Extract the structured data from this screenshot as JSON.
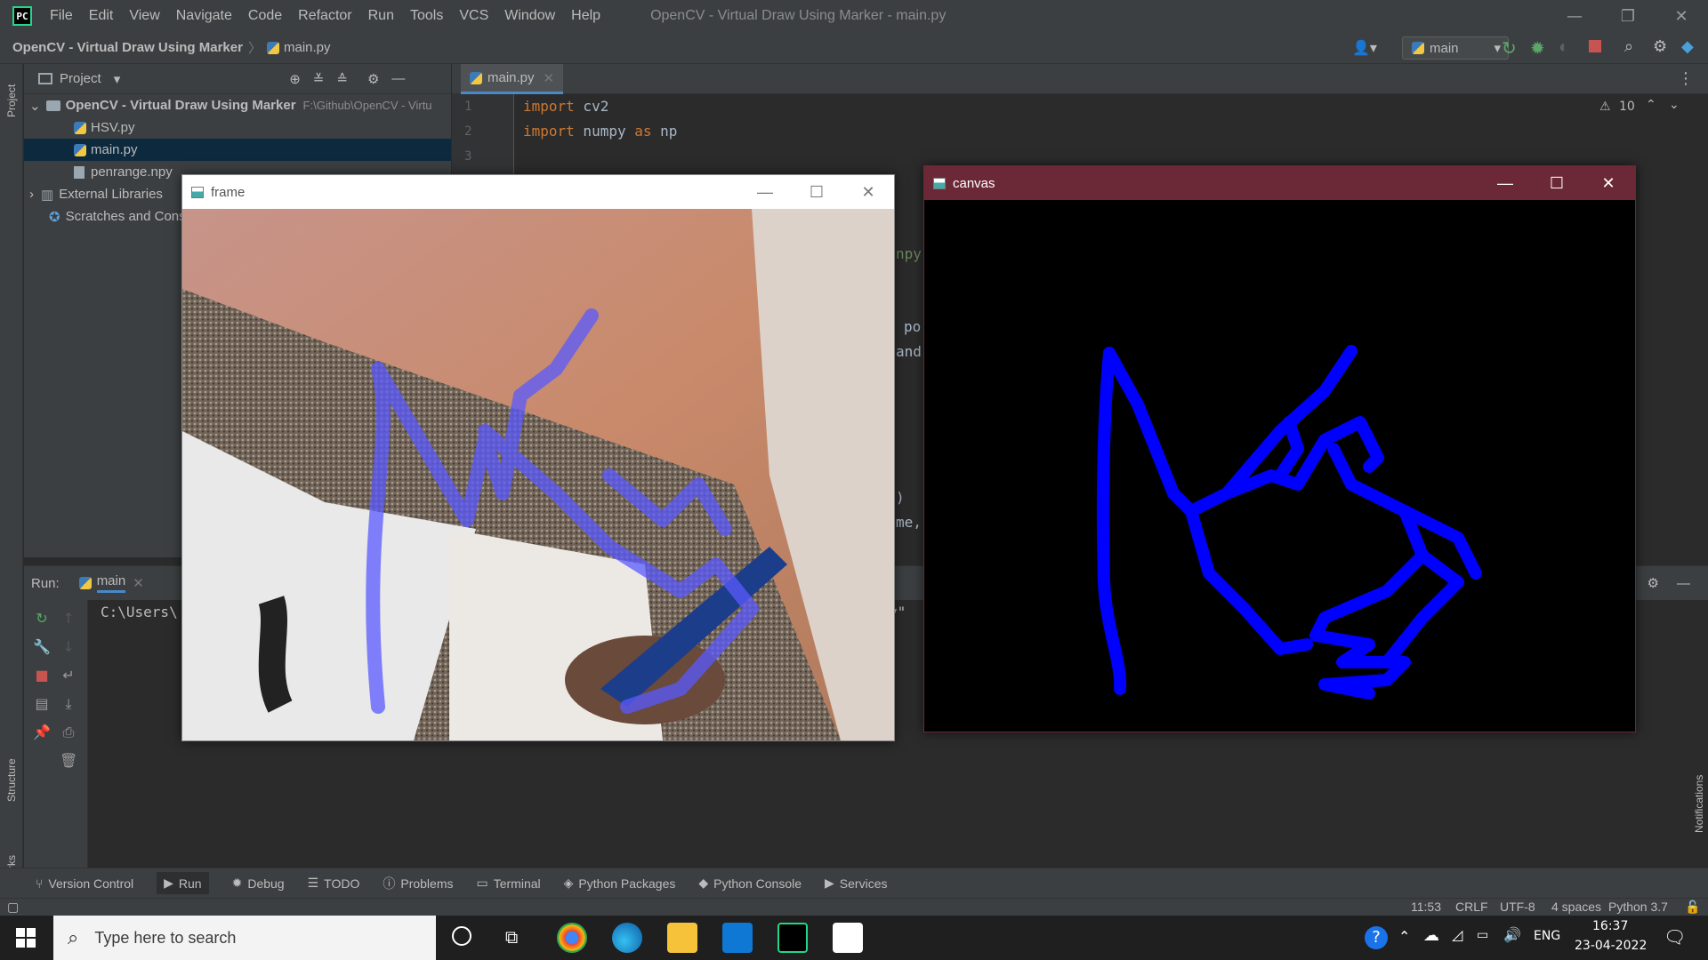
{
  "menu": {
    "items": [
      "File",
      "Edit",
      "View",
      "Navigate",
      "Code",
      "Refactor",
      "Run",
      "Tools",
      "VCS",
      "Window",
      "Help"
    ],
    "window_title": "OpenCV - Virtual Draw Using Marker - main.py"
  },
  "navbar": {
    "project": "OpenCV - Virtual Draw Using Marker",
    "file": "main.py",
    "run_config": "main"
  },
  "project_panel": {
    "title": "Project",
    "root": "OpenCV - Virtual Draw Using Marker",
    "root_path": "F:\\Github\\OpenCV - Virtu",
    "files": [
      "HSV.py",
      "main.py",
      "penrange.npy"
    ],
    "external": "External Libraries",
    "scratches": "Scratches and Cons"
  },
  "editor": {
    "tab": "main.py",
    "line_numbers": [
      "1",
      "2",
      "3"
    ],
    "line1_kw": "import",
    "line1_id": " cv2",
    "line2_kw": "import",
    "line2_id": " numpy ",
    "line2_as": "as",
    "line2_np": " np",
    "warnings": "10",
    "fragments": [
      "npy",
      "po",
      "and",
      ")",
      "me,",
      "y\""
    ]
  },
  "run_panel": {
    "label": "Run:",
    "tab": "main",
    "console": "C:\\Users\\"
  },
  "tool_strip": [
    "Version Control",
    "Run",
    "Debug",
    "TODO",
    "Problems",
    "Terminal",
    "Python Packages",
    "Python Console",
    "Services"
  ],
  "side_labels": {
    "project": "Project",
    "structure": "Structure",
    "bookmarks": "Bookmarks",
    "notifications": "Notifications"
  },
  "statusbar": {
    "position": "11:53",
    "line_sep": "CRLF",
    "encoding": "UTF-8",
    "indent": "4 spaces",
    "interpreter": "Python 3.7"
  },
  "frame_window": {
    "title": "frame"
  },
  "canvas_window": {
    "title": "canvas"
  },
  "taskbar": {
    "search_placeholder": "Type here to search",
    "language": "ENG",
    "time": "16:37",
    "date": "23-04-2022"
  },
  "colors": {
    "accent": "#4a88c7",
    "stroke": "#0000ff",
    "canvas_title_bg": "#6b2837"
  }
}
